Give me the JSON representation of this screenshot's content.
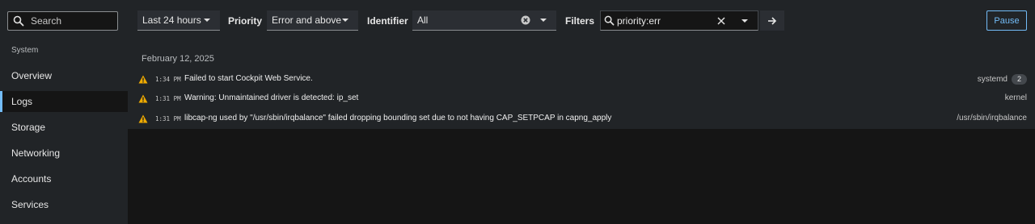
{
  "sidebar": {
    "search_placeholder": "Search",
    "section_title": "System",
    "items": [
      {
        "label": "Overview"
      },
      {
        "label": "Logs",
        "active": true
      },
      {
        "label": "Storage"
      },
      {
        "label": "Networking"
      },
      {
        "label": "Accounts"
      },
      {
        "label": "Services"
      }
    ]
  },
  "toolbar": {
    "time_range": "Last 24 hours",
    "priority_label": "Priority",
    "priority_value": "Error and above",
    "identifier_label": "Identifier",
    "identifier_value": "All",
    "filters_label": "Filters",
    "filter_text": "priority:err",
    "pause_label": "Pause"
  },
  "logs": {
    "date": "February 12, 2025",
    "entries": [
      {
        "time": "1:34 PM",
        "message": "Failed to start Cockpit Web Service.",
        "identifier": "systemd",
        "count": "2",
        "icon": "warning-icon"
      },
      {
        "time": "1:31 PM",
        "message": "Warning: Unmaintained driver is detected: ip_set",
        "identifier": "kernel",
        "count": "",
        "icon": "warning-icon"
      },
      {
        "time": "1:31 PM",
        "message": "libcap-ng used by \"/usr/sbin/irqbalance\" failed dropping bounding set due to not having CAP_SETPCAP in capng_apply",
        "identifier": "/usr/sbin/irqbalance",
        "count": "",
        "icon": "warning-icon"
      }
    ]
  },
  "colors": {
    "accent": "#73bcf7",
    "warning": "#f0ab00",
    "sidebar_bg": "#212427",
    "page_bg": "#151515"
  }
}
